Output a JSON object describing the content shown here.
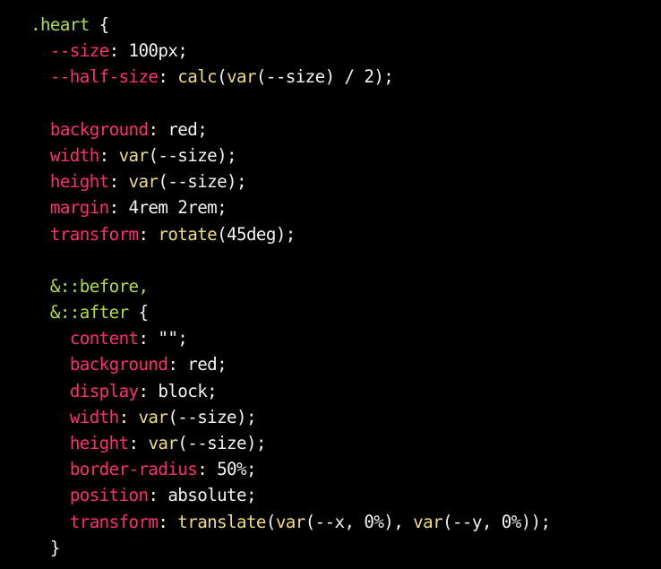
{
  "theme": {
    "background": "#000000",
    "selector": "#b2dc42",
    "property": "#ff2e72",
    "function": "#f0dc82",
    "text": "#f2f2f2"
  },
  "code": {
    "lines": [
      [
        {
          "t": "sel",
          "v": ".heart"
        },
        {
          "t": "punct",
          "v": " {"
        }
      ],
      [
        {
          "t": "plain",
          "v": "  "
        },
        {
          "t": "prop",
          "v": "--size"
        },
        {
          "t": "punct",
          "v": ": "
        },
        {
          "t": "plain",
          "v": "100px;"
        }
      ],
      [
        {
          "t": "plain",
          "v": "  "
        },
        {
          "t": "prop",
          "v": "--half-size"
        },
        {
          "t": "punct",
          "v": ": "
        },
        {
          "t": "fn",
          "v": "calc"
        },
        {
          "t": "punct",
          "v": "("
        },
        {
          "t": "fn",
          "v": "var"
        },
        {
          "t": "punct",
          "v": "(--size) / 2);"
        }
      ],
      [],
      [
        {
          "t": "plain",
          "v": "  "
        },
        {
          "t": "prop",
          "v": "background"
        },
        {
          "t": "punct",
          "v": ": "
        },
        {
          "t": "plain",
          "v": "red;"
        }
      ],
      [
        {
          "t": "plain",
          "v": "  "
        },
        {
          "t": "prop",
          "v": "width"
        },
        {
          "t": "punct",
          "v": ": "
        },
        {
          "t": "fn",
          "v": "var"
        },
        {
          "t": "punct",
          "v": "(--size);"
        }
      ],
      [
        {
          "t": "plain",
          "v": "  "
        },
        {
          "t": "prop",
          "v": "height"
        },
        {
          "t": "punct",
          "v": ": "
        },
        {
          "t": "fn",
          "v": "var"
        },
        {
          "t": "punct",
          "v": "(--size);"
        }
      ],
      [
        {
          "t": "plain",
          "v": "  "
        },
        {
          "t": "prop",
          "v": "margin"
        },
        {
          "t": "punct",
          "v": ": "
        },
        {
          "t": "plain",
          "v": "4rem 2rem;"
        }
      ],
      [
        {
          "t": "plain",
          "v": "  "
        },
        {
          "t": "prop",
          "v": "transform"
        },
        {
          "t": "punct",
          "v": ": "
        },
        {
          "t": "fn",
          "v": "rotate"
        },
        {
          "t": "punct",
          "v": "(45deg);"
        }
      ],
      [],
      [
        {
          "t": "plain",
          "v": "  "
        },
        {
          "t": "sel",
          "v": "&::before,"
        }
      ],
      [
        {
          "t": "plain",
          "v": "  "
        },
        {
          "t": "sel",
          "v": "&::after"
        },
        {
          "t": "punct",
          "v": " {"
        }
      ],
      [
        {
          "t": "plain",
          "v": "    "
        },
        {
          "t": "prop",
          "v": "content"
        },
        {
          "t": "punct",
          "v": ": "
        },
        {
          "t": "plain",
          "v": "\"\";"
        }
      ],
      [
        {
          "t": "plain",
          "v": "    "
        },
        {
          "t": "prop",
          "v": "background"
        },
        {
          "t": "punct",
          "v": ": "
        },
        {
          "t": "plain",
          "v": "red;"
        }
      ],
      [
        {
          "t": "plain",
          "v": "    "
        },
        {
          "t": "prop",
          "v": "display"
        },
        {
          "t": "punct",
          "v": ": "
        },
        {
          "t": "plain",
          "v": "block;"
        }
      ],
      [
        {
          "t": "plain",
          "v": "    "
        },
        {
          "t": "prop",
          "v": "width"
        },
        {
          "t": "punct",
          "v": ": "
        },
        {
          "t": "fn",
          "v": "var"
        },
        {
          "t": "punct",
          "v": "(--size);"
        }
      ],
      [
        {
          "t": "plain",
          "v": "    "
        },
        {
          "t": "prop",
          "v": "height"
        },
        {
          "t": "punct",
          "v": ": "
        },
        {
          "t": "fn",
          "v": "var"
        },
        {
          "t": "punct",
          "v": "(--size);"
        }
      ],
      [
        {
          "t": "plain",
          "v": "    "
        },
        {
          "t": "prop",
          "v": "border-radius"
        },
        {
          "t": "punct",
          "v": ": "
        },
        {
          "t": "plain",
          "v": "50%;"
        }
      ],
      [
        {
          "t": "plain",
          "v": "    "
        },
        {
          "t": "prop",
          "v": "position"
        },
        {
          "t": "punct",
          "v": ": "
        },
        {
          "t": "plain",
          "v": "absolute;"
        }
      ],
      [
        {
          "t": "plain",
          "v": "    "
        },
        {
          "t": "prop",
          "v": "transform"
        },
        {
          "t": "punct",
          "v": ": "
        },
        {
          "t": "fn",
          "v": "translate"
        },
        {
          "t": "punct",
          "v": "("
        },
        {
          "t": "fn",
          "v": "var"
        },
        {
          "t": "punct",
          "v": "(--x, 0%), "
        },
        {
          "t": "fn",
          "v": "var"
        },
        {
          "t": "punct",
          "v": "(--y, 0%));"
        }
      ],
      [
        {
          "t": "plain",
          "v": "  "
        },
        {
          "t": "punct",
          "v": "}"
        }
      ]
    ]
  }
}
